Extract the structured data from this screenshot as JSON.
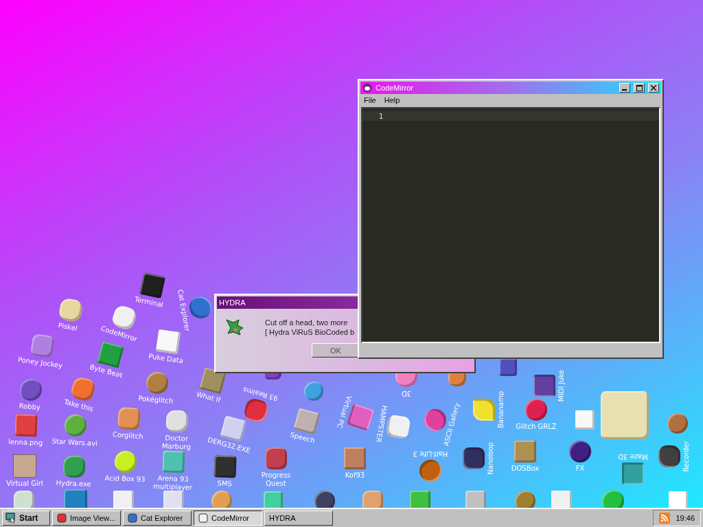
{
  "desktop": {
    "icons": [
      {
        "label": "Terminal"
      },
      {
        "label": "Cat Explorer"
      },
      {
        "label": "Piskel"
      },
      {
        "label": "CodeMirror"
      },
      {
        "label": "Puke Data"
      },
      {
        "label": "Poney Jockey"
      },
      {
        "label": "Byte Beat"
      },
      {
        "label": "Robby"
      },
      {
        "label": "Take this"
      },
      {
        "label": "Pokéglitch"
      },
      {
        "label": "What If"
      },
      {
        "label": "lenna.png"
      },
      {
        "label": "Star Wars.avi"
      },
      {
        "label": "Corglitch"
      },
      {
        "label": "Doctor Marburg"
      },
      {
        "label": "DERG32.EXE"
      },
      {
        "label": "Virtual Girl",
        "kind": "photo"
      },
      {
        "label": "Hydra.exe"
      },
      {
        "label": "Acid Box 93"
      },
      {
        "label": "Arena 93 multiplayer"
      },
      {
        "label": "SMS"
      },
      {
        "label": "Progress Quest"
      },
      {
        "label": "Speech"
      },
      {
        "label": "93 Realms"
      },
      {
        "label": "Virtual PC"
      },
      {
        "label": "HAMPSTER"
      },
      {
        "label": "ASCII Gallery"
      },
      {
        "label": "3D"
      },
      {
        "label": "Kof93"
      },
      {
        "label": "Half-Life 3"
      },
      {
        "label": "Bananamp"
      },
      {
        "label": "Glitch GRLZ"
      },
      {
        "label": "MIDI Juke"
      },
      {
        "label": "Nanoloop"
      },
      {
        "label": "DOSBox"
      },
      {
        "label": "FX"
      },
      {
        "label": "Maze 3D"
      },
      {
        "label": "Recorder"
      }
    ]
  },
  "dialog": {
    "title": "HYDRA",
    "lines": [
      "Cut off a head, two more",
      "[ Hydra ViRuS BioCoded b"
    ],
    "button": "OK"
  },
  "editor_window": {
    "title": "CodeMirror",
    "menu": [
      "File",
      "Help"
    ],
    "line_numbers": [
      "1"
    ]
  },
  "taskbar": {
    "start": "Start",
    "tasks": [
      {
        "label": "Image View...",
        "selected": false
      },
      {
        "label": "Cat Explorer",
        "selected": false
      },
      {
        "label": "CodeMirror",
        "selected": true
      },
      {
        "label": "HYDRA",
        "selected": false
      }
    ],
    "clock": "19:46"
  }
}
